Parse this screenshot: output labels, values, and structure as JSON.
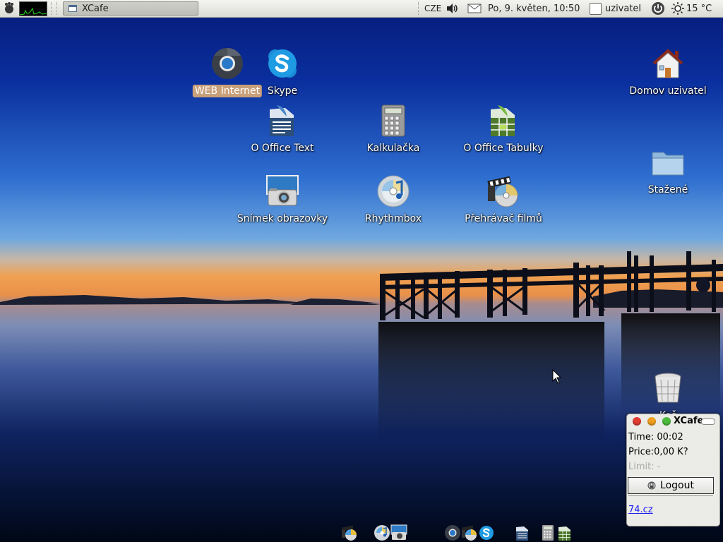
{
  "top_panel": {
    "window_task": "XCafe",
    "keyboard_layout": "CZE",
    "datetime": "Po,  9. květen, 10:50",
    "username": "uzivatel",
    "temperature": "15 °C"
  },
  "desktop": {
    "icons": [
      {
        "label": "WEB Internet",
        "icon": "chromium-icon",
        "selected": true
      },
      {
        "label": "Skype",
        "icon": "skype-icon"
      },
      {
        "label": "O Office Text",
        "icon": "openoffice-writer-icon"
      },
      {
        "label": "Kalkulačka",
        "icon": "calculator-icon"
      },
      {
        "label": "O Office Tabulky",
        "icon": "openoffice-calc-icon"
      },
      {
        "label": "Snímek obrazovky",
        "icon": "screenshot-camera-icon"
      },
      {
        "label": "Rhythmbox",
        "icon": "rhythmbox-icon"
      },
      {
        "label": "Přehrávač filmů",
        "icon": "movie-player-icon"
      },
      {
        "label": "Domov uzivatel",
        "icon": "home-folder-icon"
      },
      {
        "label": "Stažené",
        "icon": "downloads-folder-icon"
      },
      {
        "label": "Koš",
        "icon": "trash-icon"
      }
    ]
  },
  "xcafe": {
    "title": "XCafe",
    "time_line": "Time: 00:02",
    "price_line": "Price:0,00 K?",
    "limit_line": "Limit: -",
    "logout_label": "Logout",
    "link_text": "74.cz"
  },
  "dock": {
    "icons": [
      "movie-player-icon",
      "rhythmbox-icon",
      "screenshot-camera-icon",
      "chromium-icon",
      "movie-player-icon",
      "skype-icon",
      "openoffice-writer-icon",
      "calculator-icon",
      "openoffice-calc-icon"
    ]
  },
  "colors": {
    "sky_top": "#0a2a8c",
    "sky_mid": "#3f86d6",
    "sunset": "#f0a050",
    "water_dark": "#000b2a",
    "selection": "#c8a07a",
    "panel": "#e8e8e4"
  }
}
